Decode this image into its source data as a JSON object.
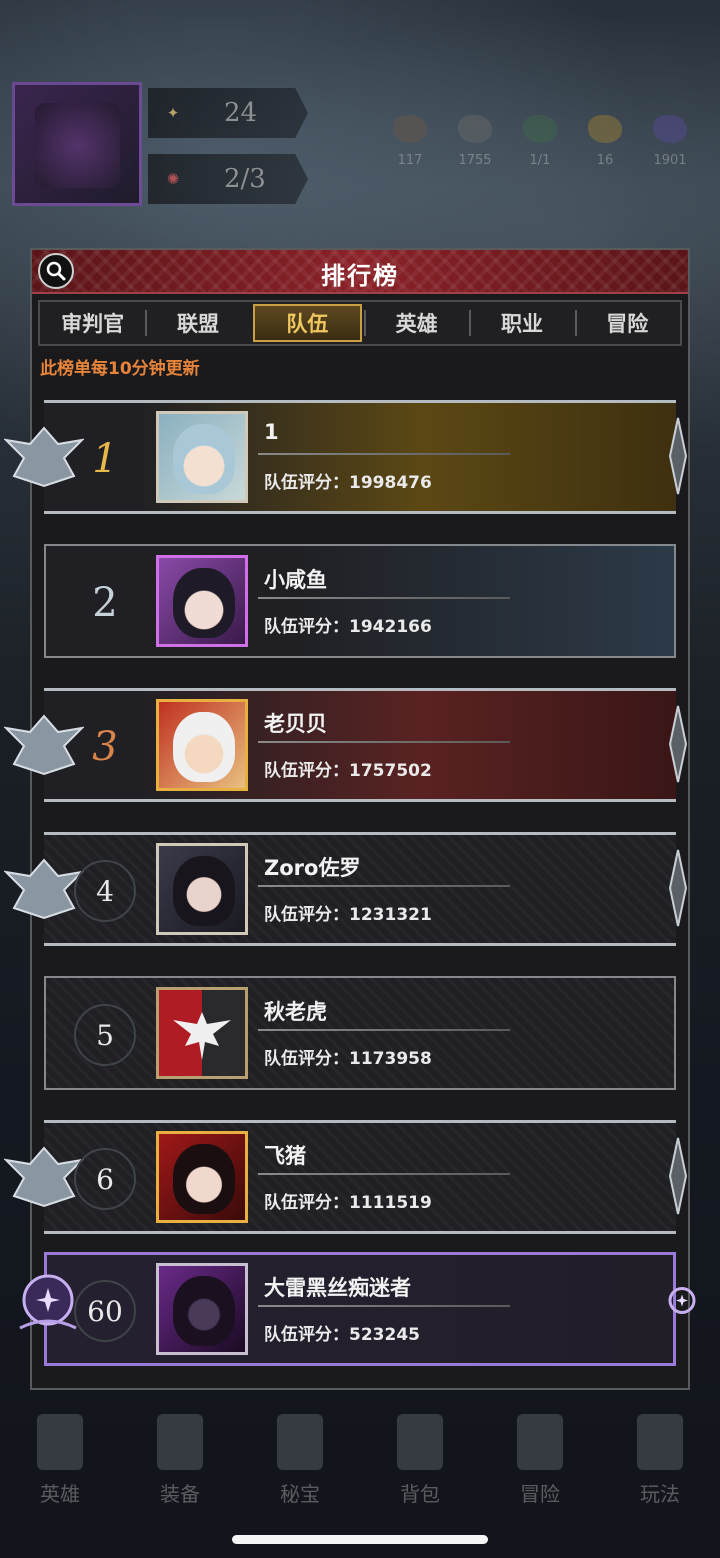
{
  "hud": {
    "level": "24",
    "progress": "2/3",
    "resources": [
      "117",
      "1755",
      "1/1",
      "16",
      "1901"
    ]
  },
  "panel": {
    "title": "排行榜",
    "tabs": [
      "审判官",
      "联盟",
      "队伍",
      "英雄",
      "职业",
      "冒险"
    ],
    "active_tab": "队伍",
    "notice": "此榜单每10分钟更新"
  },
  "score_label": "队伍评分：",
  "rankings": [
    {
      "rank": "1",
      "name": "1",
      "score": "1998476"
    },
    {
      "rank": "2",
      "name": "小咸鱼",
      "score": "1942166"
    },
    {
      "rank": "3",
      "name": "老贝贝",
      "score": "1757502"
    },
    {
      "rank": "4",
      "name": "Zoro佐罗",
      "score": "1231321"
    },
    {
      "rank": "5",
      "name": "秋老虎",
      "score": "1173958"
    },
    {
      "rank": "6",
      "name": "飞猪",
      "score": "1111519"
    }
  ],
  "my_rank": {
    "rank": "60",
    "name": "大雷黑丝痴迷者",
    "score": "523245"
  },
  "bottom_nav": [
    "英雄",
    "装备",
    "秘宝",
    "背包",
    "冒险",
    "玩法"
  ],
  "colors": {
    "accent_gold": "#e6b84a",
    "notice": "#e8843a",
    "header_red": "#8a2228",
    "my_frame": "#9a7ad8"
  }
}
